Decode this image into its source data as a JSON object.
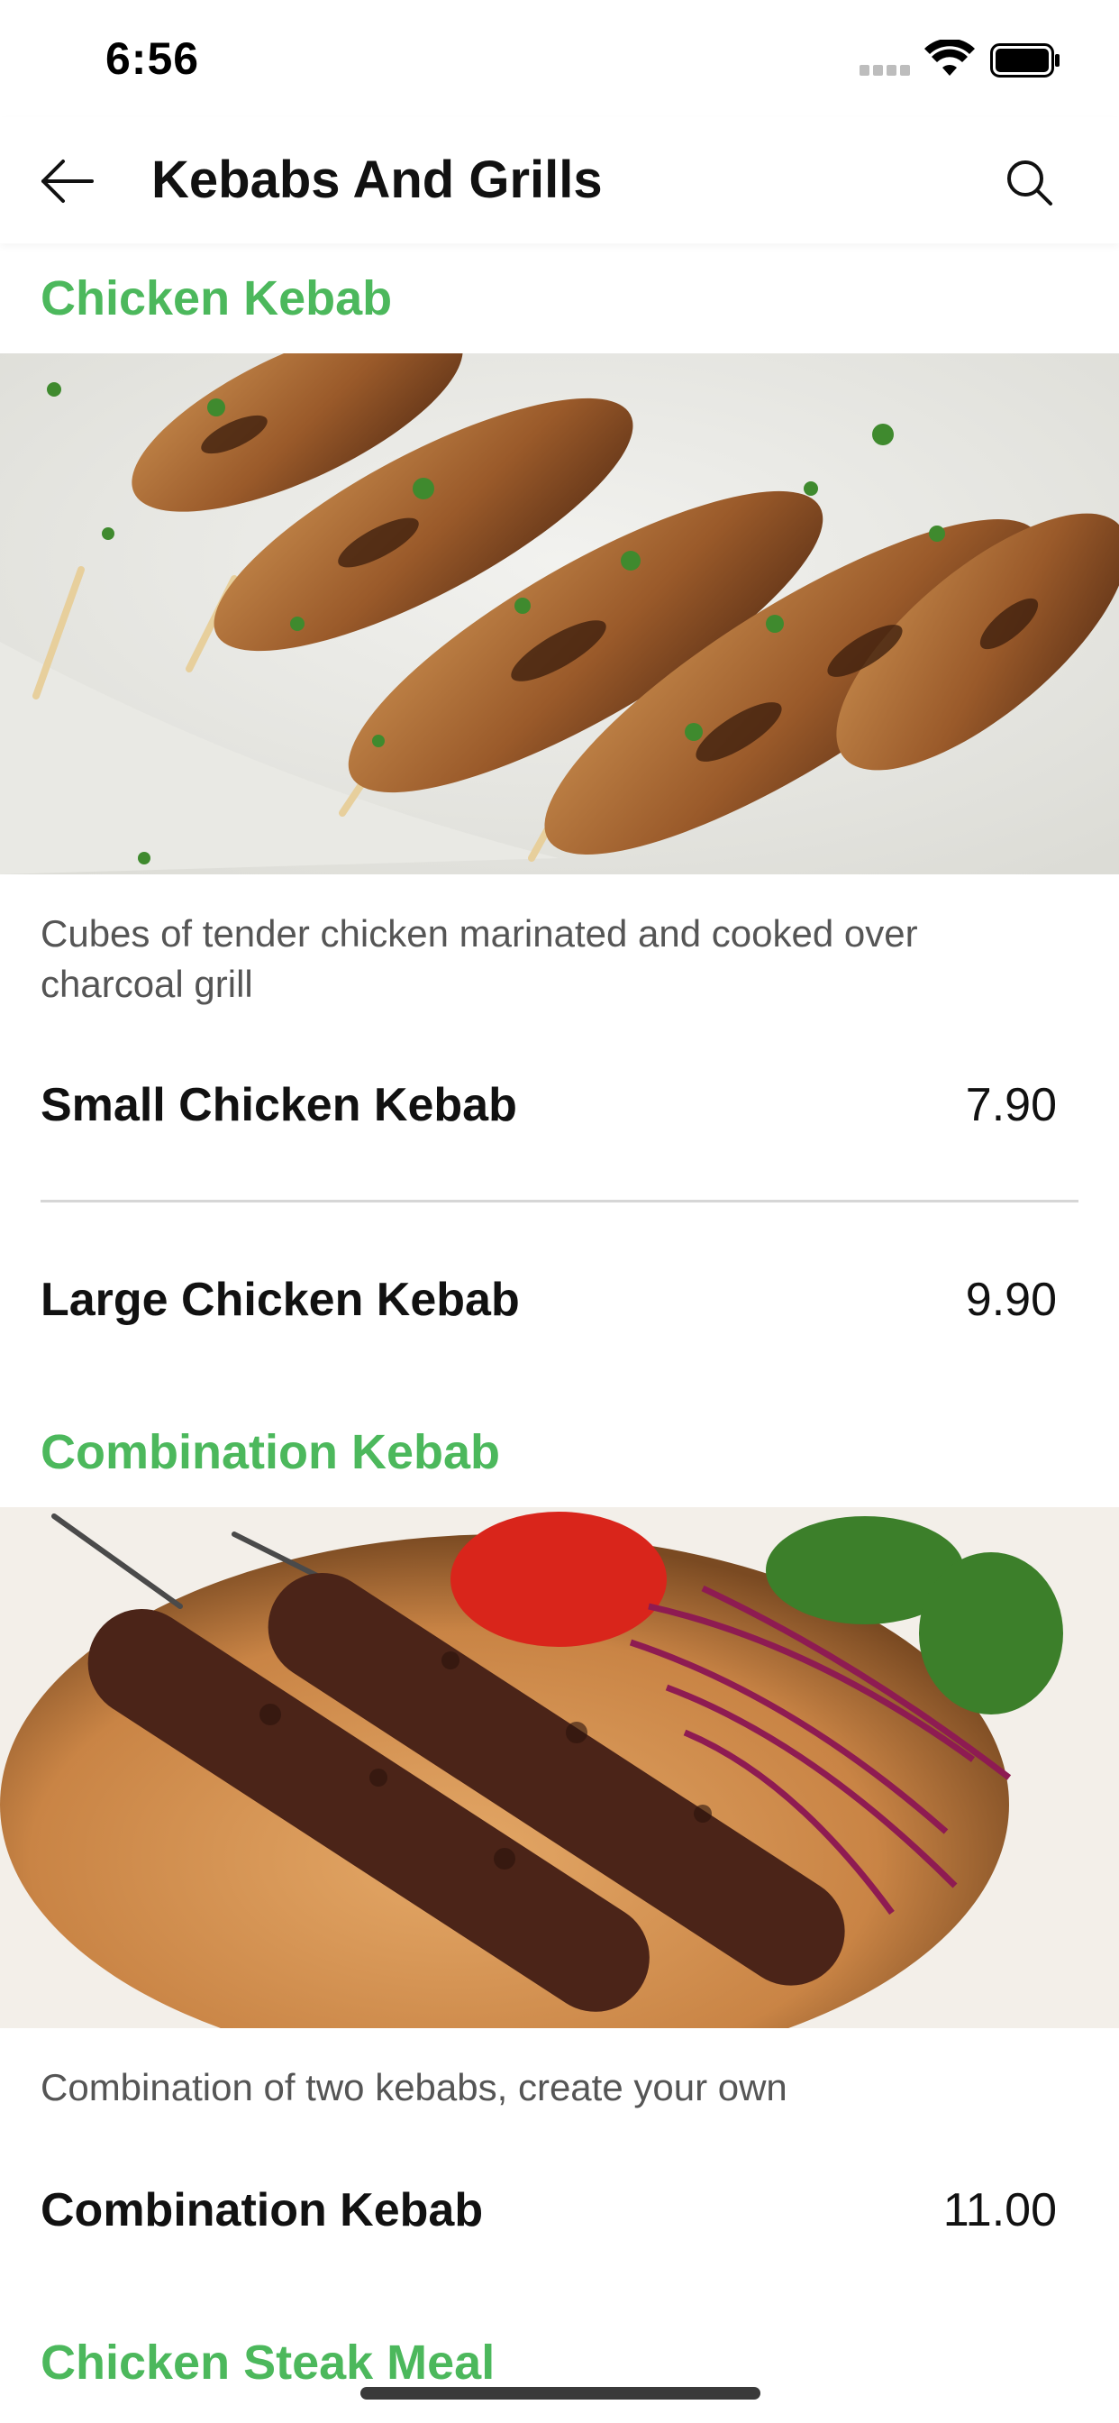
{
  "status_bar": {
    "time": "6:56"
  },
  "header": {
    "title": "Kebabs And Grills",
    "back_icon": "arrow-left-icon",
    "search_icon": "search-icon"
  },
  "sections": [
    {
      "title": "Chicken Kebab",
      "image": "grilled-chicken-skewers-photo",
      "description": "Cubes of tender chicken marinated and cooked over charcoal grill",
      "items": [
        {
          "name": "Small Chicken Kebab",
          "price": "7.90"
        },
        {
          "name": "Large Chicken Kebab",
          "price": "9.90"
        }
      ]
    },
    {
      "title": "Combination Kebab",
      "image": "kofta-kebab-on-flatbread-photo",
      "description": "Combination of two kebabs, create your own",
      "items": [
        {
          "name": "Combination Kebab",
          "price": "11.00"
        }
      ]
    },
    {
      "title": "Chicken Steak Meal"
    }
  ],
  "colors": {
    "accent_green": "#4cb85c",
    "text_primary": "#111111",
    "text_secondary": "#555555",
    "divider": "#d6d6d6"
  }
}
